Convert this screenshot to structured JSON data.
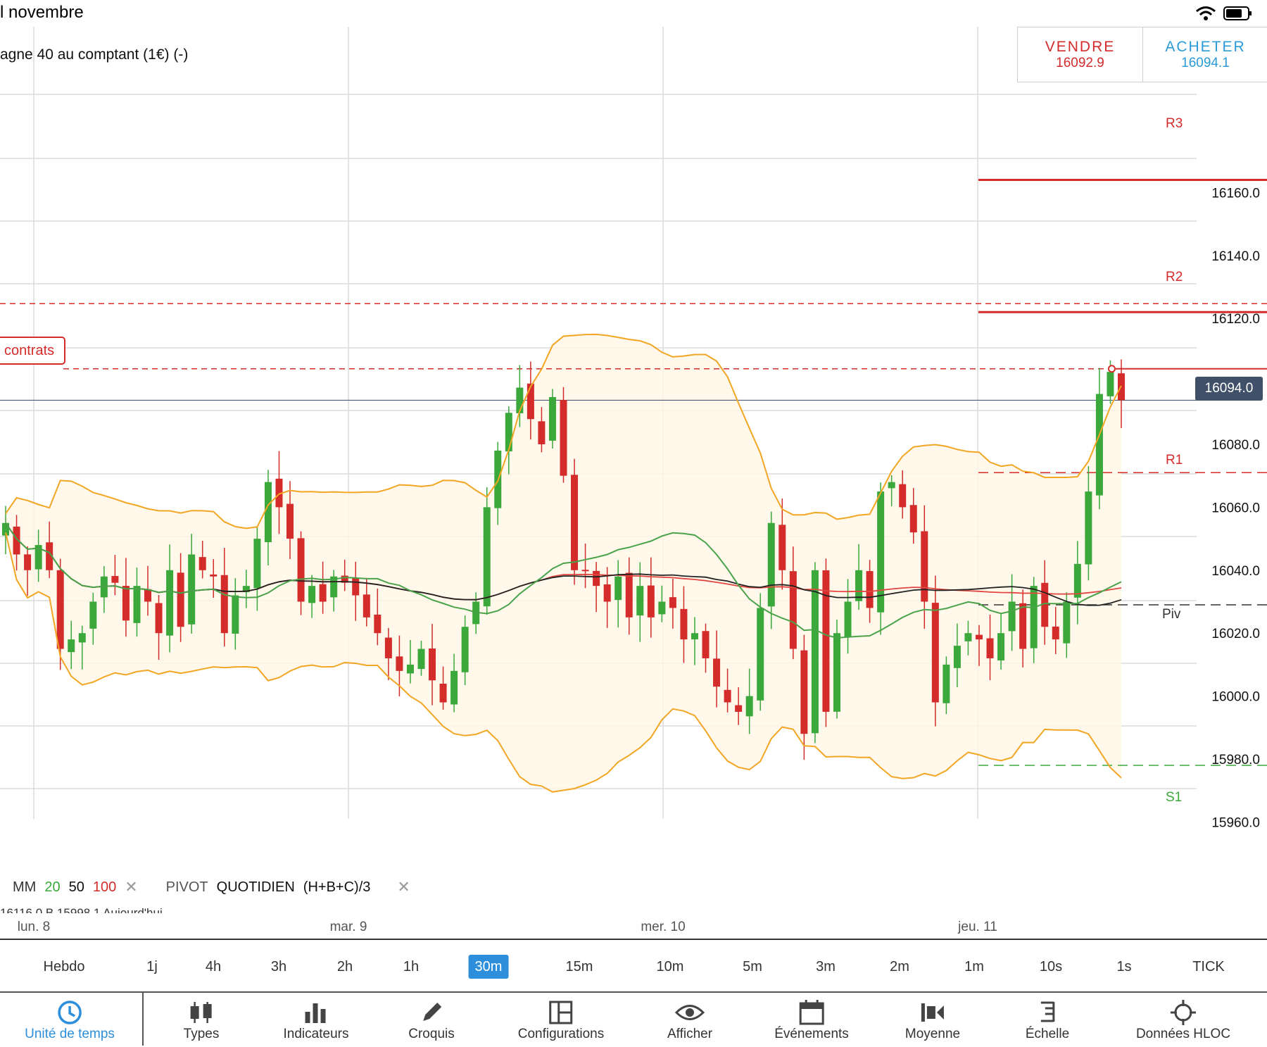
{
  "status": {
    "date": "l novembre"
  },
  "instrument": {
    "name": "agne 40 au comptant (1€) (-)"
  },
  "trade": {
    "sell_label": "VENDRE",
    "sell_price": "16092.9",
    "buy_label": "ACHETER",
    "buy_price": "16094.1"
  },
  "order": {
    "label": "contrats"
  },
  "last_price": "16094.0",
  "levels": {
    "r3": "R3",
    "r2": "R2",
    "r1": "R1",
    "piv": "Piv",
    "s1": "S1"
  },
  "colors": {
    "up": "#3aa83a",
    "down": "#d42b2b",
    "bollinger": "#f2a623",
    "ma20": "#4aa34a",
    "ma50": "#222222",
    "ma100": "#e0473f",
    "accent": "#2d8fdb"
  },
  "legend": {
    "ma_label": "MM",
    "ma20": "20",
    "ma50": "50",
    "ma100": "100",
    "pivot_label": "PIVOT",
    "pivot_period": "QUOTIDIEN",
    "pivot_formula": "(H+B+C)/3",
    "remove_icon": "✕"
  },
  "ohlc_cut": "16116.0   B 15998.1   Aujourd'hui",
  "dates": [
    "lun. 8",
    "mar. 9",
    "mer. 10",
    "jeu. 11"
  ],
  "timeframes": [
    "Hebdo",
    "1j",
    "4h",
    "3h",
    "2h",
    "1h",
    "30m",
    "15m",
    "10m",
    "5m",
    "3m",
    "2m",
    "1m",
    "10s",
    "1s",
    "TICK"
  ],
  "active_timeframe": "30m",
  "toolbar": [
    {
      "label": "Unité de temps",
      "icon": "clock-icon"
    },
    {
      "label": "Types",
      "icon": "candles-icon"
    },
    {
      "label": "Indicateurs",
      "icon": "bars-icon"
    },
    {
      "label": "Croquis",
      "icon": "pencil-icon"
    },
    {
      "label": "Configurations",
      "icon": "layout-icon"
    },
    {
      "label": "Afficher",
      "icon": "eye-icon"
    },
    {
      "label": "Événements",
      "icon": "calendar-icon"
    },
    {
      "label": "Moyenne",
      "icon": "average-icon"
    },
    {
      "label": "Échelle",
      "icon": "scale-icon"
    },
    {
      "label": "Données HLOC",
      "icon": "crosshair-icon"
    }
  ],
  "chart_data": {
    "type": "candlestick",
    "price_ticks": [
      "16160.0",
      "16140.0",
      "16120.0",
      "16100.0",
      "16080.0",
      "16060.0",
      "16040.0",
      "16020.0",
      "16000.0",
      "15980.0",
      "15960.0"
    ],
    "ylim": [
      15960,
      16160
    ],
    "pivot_levels": {
      "R3": 16164,
      "R2": 16122,
      "R1": 16071,
      "Piv": 16029,
      "S1": 15978
    },
    "order_level": 16104,
    "last_price": 16094.0,
    "closes": [
      16055,
      16045,
      16040,
      16048,
      16040,
      16015,
      16018,
      16020,
      16030,
      16038,
      16036,
      16024,
      16035,
      16030,
      16020,
      16040,
      16022,
      16045,
      16040,
      16038,
      16020,
      16032,
      16035,
      16050,
      16068,
      16060,
      16050,
      16030,
      16035,
      16030,
      16038,
      16036,
      16032,
      16025,
      16020,
      16012,
      16008,
      16010,
      16015,
      16005,
      15998,
      16008,
      16022,
      16030,
      16060,
      16078,
      16090,
      16098,
      16088,
      16080,
      16095,
      16070,
      16040,
      16040,
      16035,
      16030,
      16038,
      16025,
      16035,
      16025,
      16030,
      16028,
      16018,
      16020,
      16012,
      16003,
      15998,
      15995,
      16000,
      16028,
      16055,
      16040,
      16015,
      15988,
      16040,
      15995,
      16020,
      16030,
      16040,
      16028,
      16065,
      16068,
      16060,
      16052,
      16030,
      15998,
      16010,
      16016,
      16020,
      16018,
      16012,
      16020,
      16030,
      16015,
      16035,
      16022,
      16018,
      16030,
      16042,
      16065,
      16096,
      16103,
      16094
    ],
    "series": [
      "Bollinger upper",
      "Bollinger lower",
      "MM 20",
      "MM 50",
      "MM 100"
    ]
  }
}
